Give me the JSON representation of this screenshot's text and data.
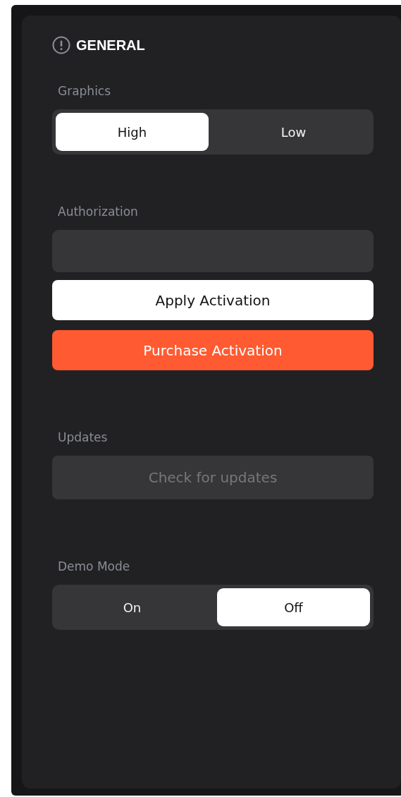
{
  "header": {
    "title": "GENERAL"
  },
  "sections": [
    {
      "kind": "segmented",
      "label": "Graphics",
      "options": [
        {
          "label": "High",
          "selected": true
        },
        {
          "label": "Low",
          "selected": false
        }
      ]
    },
    {
      "kind": "activation",
      "label": "Authorization",
      "buttons": [
        {
          "label": "Apply Activation",
          "kind": "light",
          "disabled": false
        },
        {
          "label": "Purchase Activation",
          "kind": "accent",
          "disabled": false
        }
      ]
    },
    {
      "kind": "actions",
      "label": "Updates",
      "buttons": [
        {
          "label": "Check for updates",
          "kind": "dark",
          "disabled": true
        }
      ]
    },
    {
      "kind": "segmented",
      "label": "Demo Mode",
      "options": [
        {
          "label": "On",
          "selected": false
        },
        {
          "label": "Off",
          "selected": true
        }
      ]
    }
  ]
}
